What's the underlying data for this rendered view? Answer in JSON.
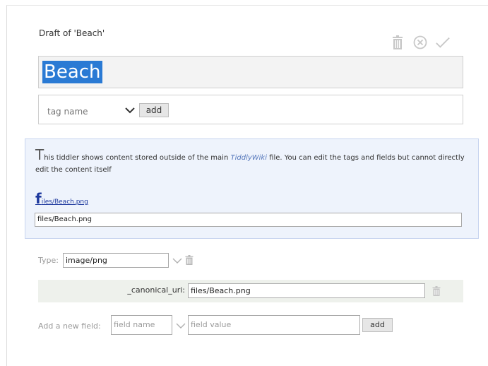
{
  "draft": {
    "heading": "Draft of 'Beach'"
  },
  "toolbar": {
    "delete_icon": "trash-icon",
    "cancel_icon": "close-circle-icon",
    "done_icon": "checkmark-icon"
  },
  "title": {
    "value": "Beach"
  },
  "tags": {
    "placeholder": "tag name",
    "add_label": "add"
  },
  "info": {
    "dropcap": "T",
    "text_before": "his tiddler shows content stored outside of the main ",
    "link_text": "TiddlyWiki",
    "text_after": " file. You can edit the tags and fields but cannot directly edit the content itself",
    "file_link_first": "f",
    "file_link_rest": "iles/Beach.png",
    "file_path": "files/Beach.png"
  },
  "type_field": {
    "label": "Type:",
    "value": "image/png"
  },
  "fields": [
    {
      "name": "_canonical_uri:",
      "value": "files/Beach.png"
    }
  ],
  "new_field": {
    "label": "Add a new field:",
    "name_placeholder": "field name",
    "value_placeholder": "field value",
    "add_label": "add"
  },
  "colors": {
    "selection": "#2a7ad4",
    "info_bg": "#eef3fc",
    "field_row_bg": "#eef1ec"
  }
}
